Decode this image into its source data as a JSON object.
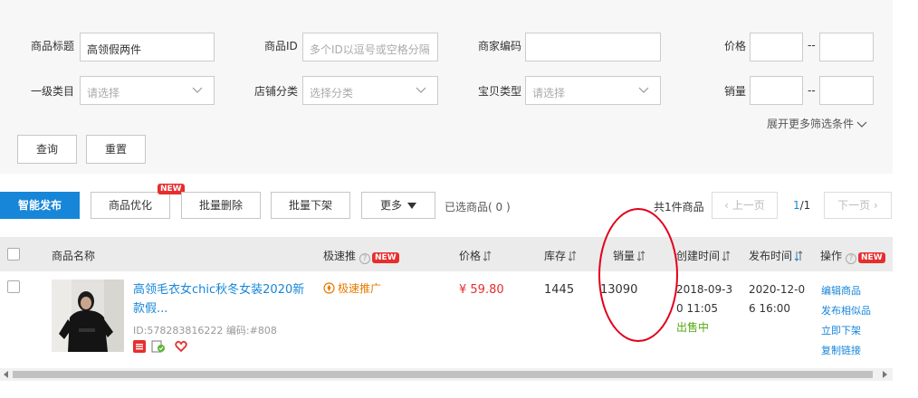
{
  "filters": {
    "product_title": {
      "label": "商品标题",
      "value": "高领假两件"
    },
    "product_id": {
      "label": "商品ID",
      "placeholder": "多个ID以逗号或空格分隔"
    },
    "merchant_code": {
      "label": "商家编码",
      "value": ""
    },
    "price": {
      "label": "价格",
      "min": "",
      "max": "",
      "separator": "--"
    },
    "category": {
      "label": "一级类目",
      "placeholder": "请选择"
    },
    "shop_category": {
      "label": "店铺分类",
      "placeholder": "选择分类"
    },
    "item_type": {
      "label": "宝贝类型",
      "placeholder": "请选择"
    },
    "sales": {
      "label": "销量",
      "min": "",
      "max": "",
      "separator": "--"
    },
    "expand_label": "展开更多筛选条件",
    "query_button": "查询",
    "reset_button": "重置"
  },
  "toolbar": {
    "smart_publish": "智能发布",
    "optimize": "商品优化",
    "optimize_badge": "NEW",
    "batch_delete": "批量删除",
    "batch_unlist": "批量下架",
    "more": "更多",
    "selected": "已选商品( 0 )",
    "total": "共1件商品",
    "prev_page": "上一页",
    "page_current": "1",
    "page_total": "/1",
    "next_page": "下一页"
  },
  "table": {
    "columns": {
      "name": "商品名称",
      "promotion": "极速推",
      "promotion_badge": "NEW",
      "price": "价格",
      "stock": "库存",
      "sales": "销量",
      "created": "创建时间",
      "published": "发布时间",
      "actions": "操作",
      "actions_badge": "NEW"
    },
    "rows": [
      {
        "title": "高领毛衣女chic秋冬女装2020新款假...",
        "id_line": "ID:578283816222 编码:#808",
        "promotion": "极速推广",
        "price": "¥ 59.80",
        "stock": "1445",
        "sales": "13090",
        "created_line1": "2018-09-3",
        "created_line2": "0 11:05",
        "status": "出售中",
        "published_line1": "2020-12-0",
        "published_line2": "6 16:00",
        "actions": [
          "编辑商品",
          "发布相似品",
          "立即下架",
          "复制链接"
        ]
      }
    ]
  },
  "colors": {
    "primary": "#1786d8",
    "price_red": "#e62e2e",
    "status_green": "#52a810",
    "annotation_red": "#e2001a"
  }
}
